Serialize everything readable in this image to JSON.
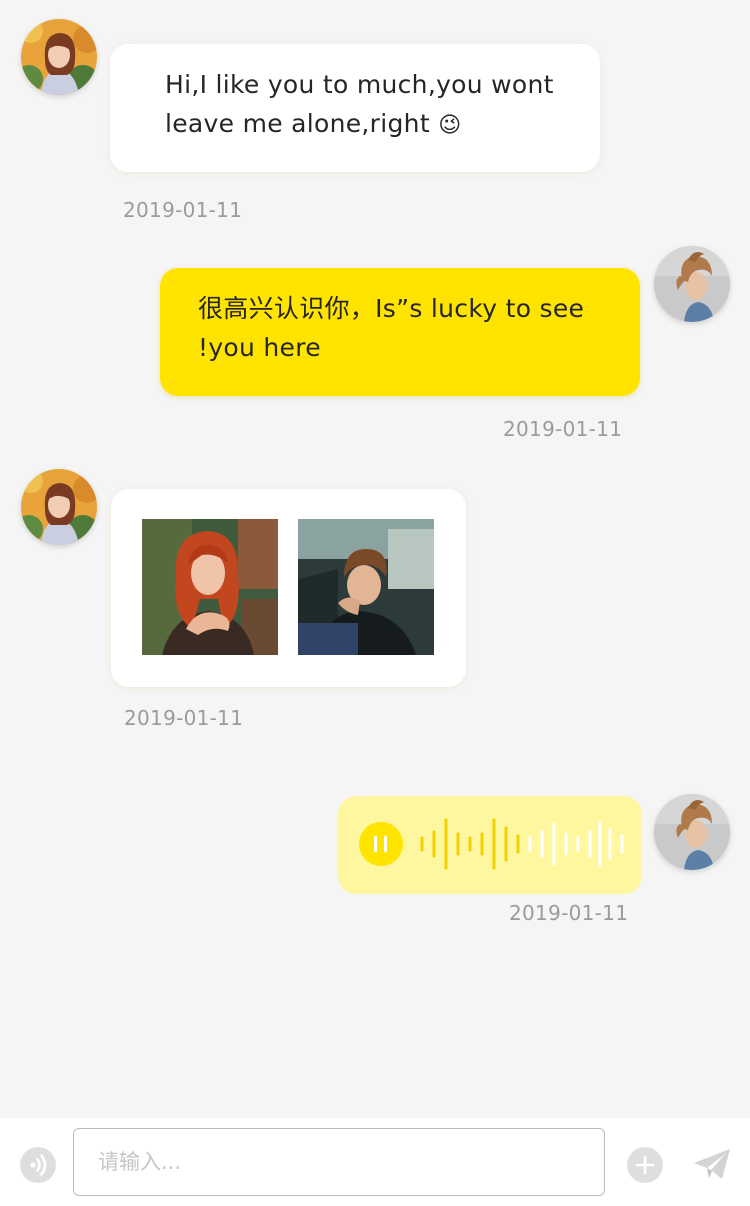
{
  "messages": [
    {
      "side": "left",
      "type": "text",
      "text_line1": "Hi,I like you to much,you wont",
      "text_line2": "leave me alone,right",
      "emoji": "😉",
      "time": "2019-01-11"
    },
    {
      "side": "right",
      "type": "text",
      "text_line1": "很高兴认识你，Is”s lucky to see",
      "text_line2": "!you here",
      "time": "2019-01-11"
    },
    {
      "side": "left",
      "type": "images",
      "images": [
        "photo-red-haired-woman",
        "photo-boy-in-car"
      ],
      "time": "2019-01-11"
    },
    {
      "side": "right",
      "type": "voice",
      "state": "playing",
      "time": "2019-01-11"
    }
  ],
  "input": {
    "placeholder": "请输入...",
    "value": ""
  },
  "icons": {
    "voice_toggle": "voice-wave-icon",
    "add": "plus-icon",
    "send": "paper-plane-icon",
    "pause": "pause-icon"
  },
  "colors": {
    "background": "#f5f5f5",
    "accent_yellow": "#ffe400",
    "voice_bubble": "#fff6a0",
    "timestamp": "#9b9b9b",
    "icon_gray": "#dedede"
  }
}
